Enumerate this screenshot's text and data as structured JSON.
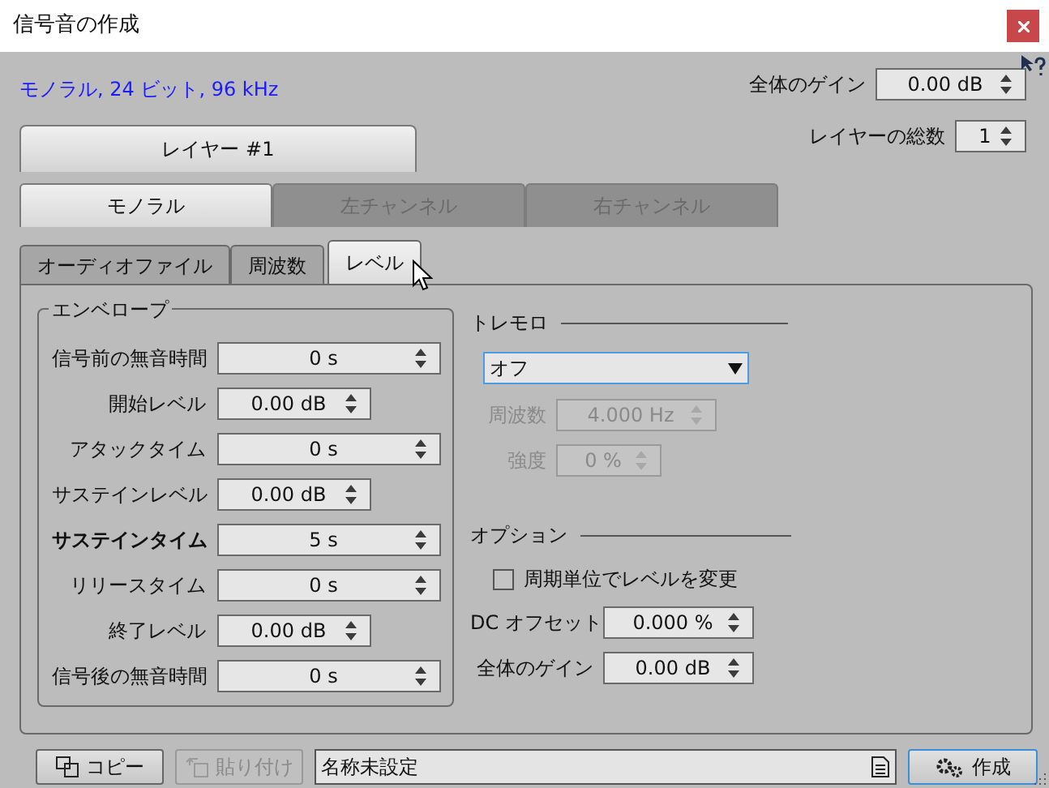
{
  "window": {
    "title": "信号音の作成"
  },
  "format_info": "モノラル, 24 ビット, 96 kHz",
  "master_gain": {
    "label": "全体のゲイン",
    "value": "0.00 dB"
  },
  "layer_tabs": [
    {
      "label": "レイヤー #1",
      "selected": true
    }
  ],
  "layer_count": {
    "label": "レイヤーの総数",
    "value": "1"
  },
  "channel_tabs": [
    {
      "label": "モノラル",
      "selected": true,
      "disabled": false
    },
    {
      "label": "左チャンネル",
      "selected": false,
      "disabled": true
    },
    {
      "label": "右チャンネル",
      "selected": false,
      "disabled": true
    }
  ],
  "sub_tabs": [
    {
      "label": "オーディオファイル",
      "selected": false
    },
    {
      "label": "周波数",
      "selected": false
    },
    {
      "label": "レベル",
      "selected": true
    }
  ],
  "envelope": {
    "title": "エンベロープ",
    "rows": [
      {
        "label": "信号前の無音時間",
        "value": "0 s",
        "kind": "time",
        "bold": false
      },
      {
        "label": "開始レベル",
        "value": "0.00 dB",
        "kind": "level",
        "bold": false
      },
      {
        "label": "アタックタイム",
        "value": "0 s",
        "kind": "time",
        "bold": false
      },
      {
        "label": "サステインレベル",
        "value": "0.00 dB",
        "kind": "level",
        "bold": false
      },
      {
        "label": "サステインタイム",
        "value": "5 s",
        "kind": "time",
        "bold": true
      },
      {
        "label": "リリースタイム",
        "value": "0 s",
        "kind": "time",
        "bold": false
      },
      {
        "label": "終了レベル",
        "value": "0.00 dB",
        "kind": "level",
        "bold": false
      },
      {
        "label": "信号後の無音時間",
        "value": "0 s",
        "kind": "time",
        "bold": false
      }
    ]
  },
  "tremolo": {
    "title": "トレモロ",
    "mode": {
      "value": "オフ"
    },
    "rows": [
      {
        "label": "周波数",
        "value": "4.000 Hz",
        "disabled": true
      },
      {
        "label": "強度",
        "value": "0 %",
        "disabled": true
      }
    ]
  },
  "options": {
    "title": "オプション",
    "checkbox": {
      "label": "周期単位でレベルを変更",
      "checked": false
    },
    "rows": [
      {
        "label": "DC オフセット",
        "value": "0.000 %"
      },
      {
        "label": "全体のゲイン",
        "value": "0.00 dB"
      }
    ]
  },
  "footer": {
    "copy_button": {
      "label": "コピー",
      "disabled": false
    },
    "paste_button": {
      "label": "貼り付け",
      "disabled": true
    },
    "name_field": {
      "value": "名称未設定"
    },
    "create_button": {
      "label": "作成"
    }
  }
}
